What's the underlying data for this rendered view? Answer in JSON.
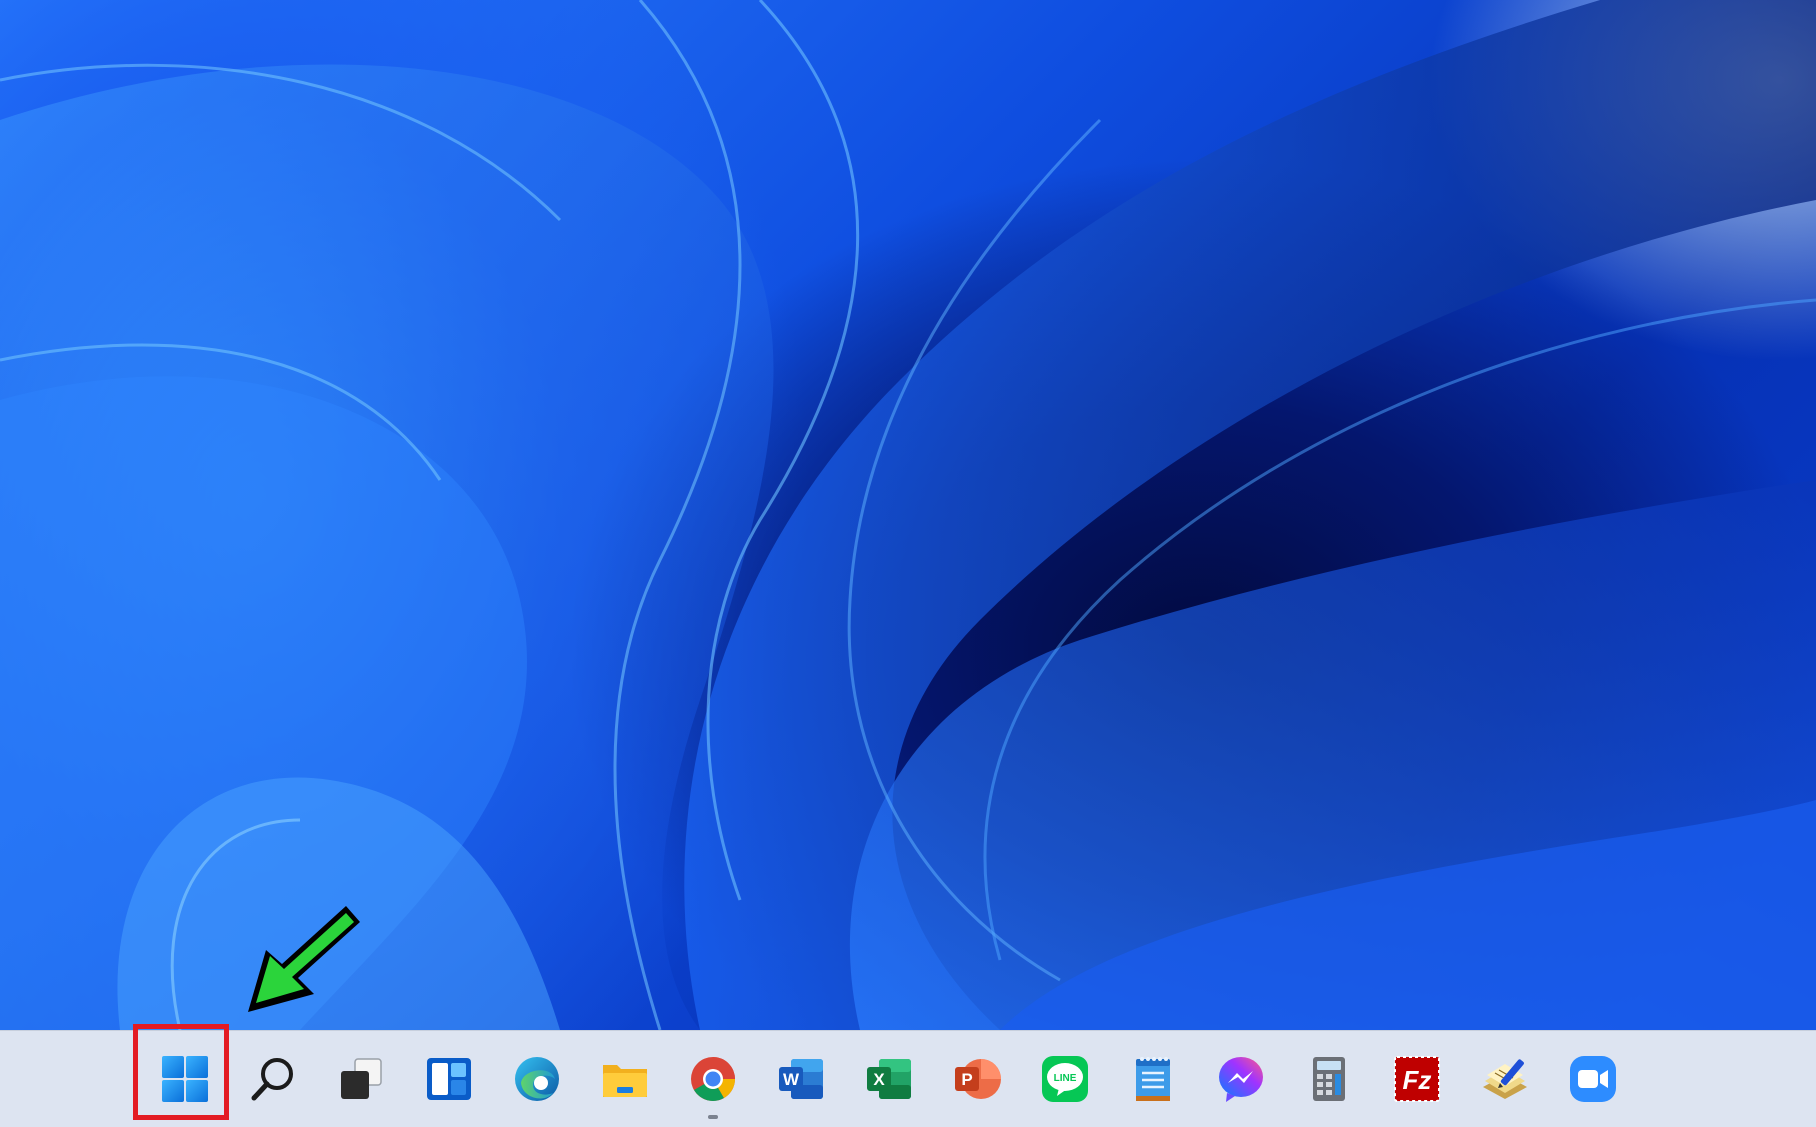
{
  "desktop": {
    "wallpaper": "windows-11-bloom",
    "colors": {
      "light": "#2f8cff",
      "mid": "#1552e6",
      "dark": "#04166e"
    }
  },
  "taskbar": {
    "background": "#dde4f1",
    "icons": [
      {
        "icon": "start-icon",
        "running": false,
        "highlighted": true
      },
      {
        "icon": "search-icon",
        "running": false
      },
      {
        "icon": "task-view-icon",
        "running": false
      },
      {
        "icon": "widgets-icon",
        "running": false
      },
      {
        "icon": "edge-icon",
        "running": false
      },
      {
        "icon": "file-explorer-icon",
        "running": false
      },
      {
        "icon": "chrome-icon",
        "running": true
      },
      {
        "icon": "word-icon",
        "running": false,
        "glyph": "W"
      },
      {
        "icon": "excel-icon",
        "running": false,
        "glyph": "X"
      },
      {
        "icon": "powerpoint-icon",
        "running": false,
        "glyph": "P"
      },
      {
        "icon": "line-icon",
        "running": false,
        "glyph": "LINE"
      },
      {
        "icon": "notepad-icon",
        "running": false
      },
      {
        "icon": "messenger-icon",
        "running": false
      },
      {
        "icon": "calculator-icon",
        "running": false
      },
      {
        "icon": "filezilla-icon",
        "running": false,
        "glyph": "Fz"
      },
      {
        "icon": "notes-pen-icon",
        "running": false
      },
      {
        "icon": "zoom-icon",
        "running": false
      }
    ]
  },
  "annotation": {
    "highlight_color": "#e31b23",
    "arrow_color": "#2bd43b"
  }
}
